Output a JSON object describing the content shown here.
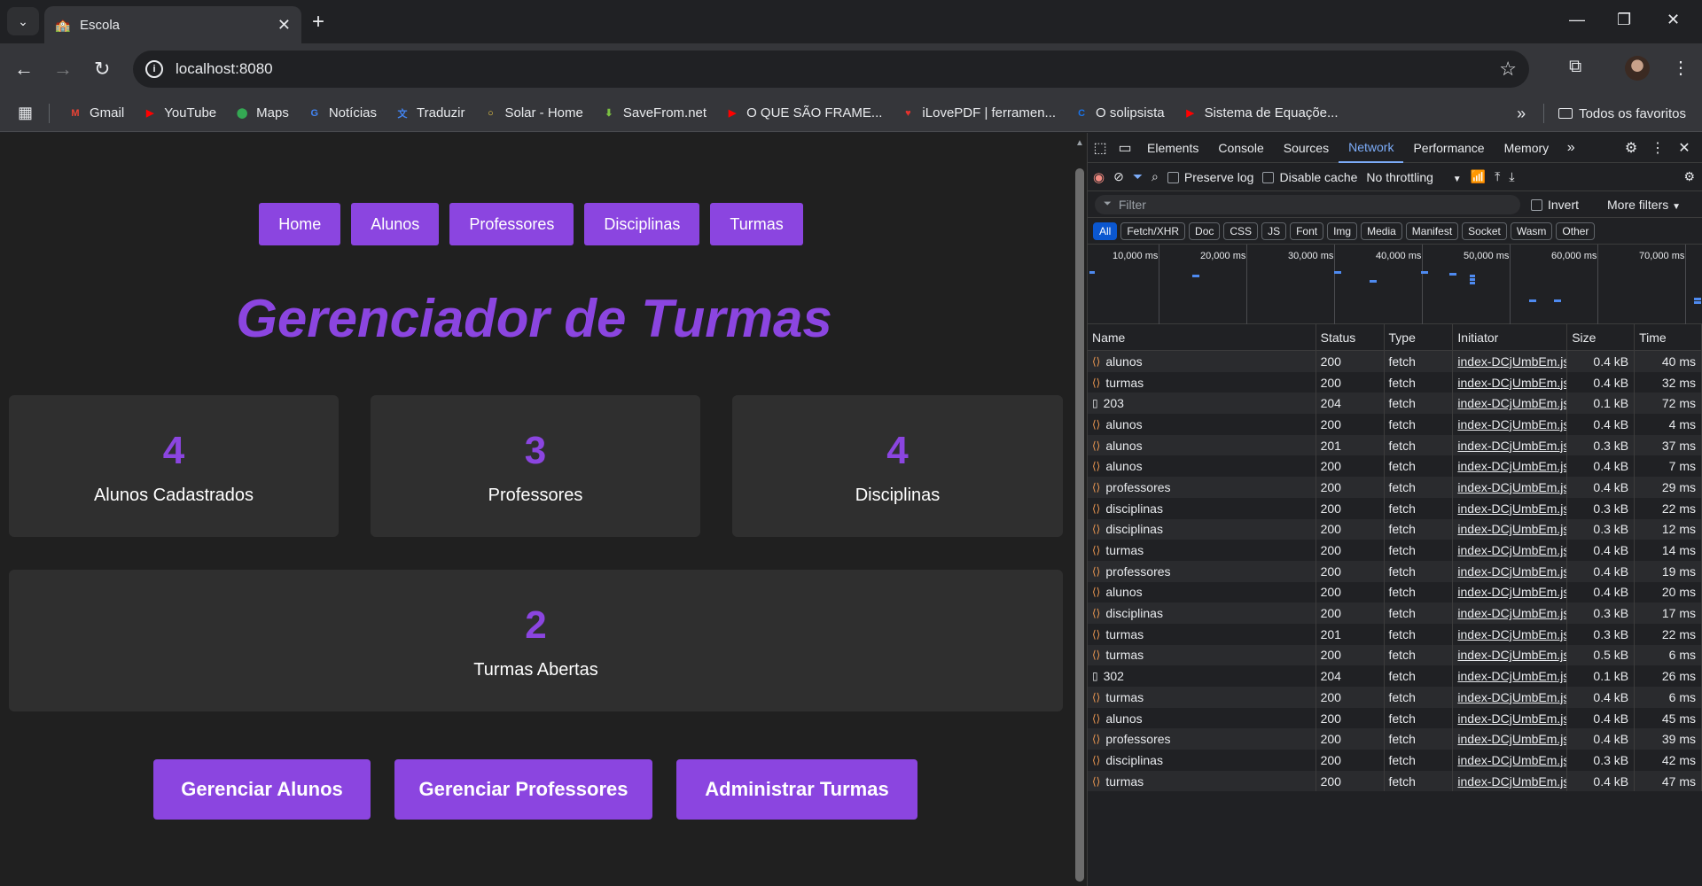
{
  "browser": {
    "tab_title": "Escola",
    "url": "localhost:8080",
    "bookmarks": [
      {
        "label": "Gmail",
        "icon": "gmail-icon",
        "color": "#ea4335",
        "glyph": "M"
      },
      {
        "label": "YouTube",
        "icon": "youtube-icon",
        "color": "#ff0000",
        "glyph": "▶"
      },
      {
        "label": "Maps",
        "icon": "maps-icon",
        "color": "#34a853",
        "glyph": "⬤"
      },
      {
        "label": "Notícias",
        "icon": "news-icon",
        "color": "#4285f4",
        "glyph": "G"
      },
      {
        "label": "Traduzir",
        "icon": "translate-icon",
        "color": "#4285f4",
        "glyph": "文"
      },
      {
        "label": "Solar - Home",
        "icon": "solar-icon",
        "color": "#f6d44a",
        "glyph": "○"
      },
      {
        "label": "SaveFrom.net",
        "icon": "savefrom-icon",
        "color": "#7cc142",
        "glyph": "⬇"
      },
      {
        "label": "O QUE SÃO FRAME...",
        "icon": "youtube-icon",
        "color": "#ff0000",
        "glyph": "▶"
      },
      {
        "label": "iLovePDF | ferramen...",
        "icon": "ilovepdf-icon",
        "color": "#e5322d",
        "glyph": "♥"
      },
      {
        "label": "O solipsista",
        "icon": "blog-icon",
        "color": "#1a73e8",
        "glyph": "C"
      },
      {
        "label": "Sistema de Equaçõe...",
        "icon": "youtube-icon",
        "color": "#ff0000",
        "glyph": "▶"
      }
    ],
    "all_favorites": "Todos os favoritos"
  },
  "app": {
    "nav": [
      "Home",
      "Alunos",
      "Professores",
      "Disciplinas",
      "Turmas"
    ],
    "heading": "Gerenciador de Turmas",
    "stats": [
      {
        "value": "4",
        "label": "Alunos Cadastrados"
      },
      {
        "value": "3",
        "label": "Professores"
      },
      {
        "value": "4",
        "label": "Disciplinas"
      },
      {
        "value": "2",
        "label": "Turmas Abertas"
      }
    ],
    "actions": [
      "Gerenciar Alunos",
      "Gerenciar Professores",
      "Administrar Turmas"
    ],
    "accent_color": "#8b45e0"
  },
  "devtools": {
    "tabs": [
      "Elements",
      "Console",
      "Sources",
      "Network",
      "Performance",
      "Memory"
    ],
    "active_tab": "Network",
    "preserve_log": "Preserve log",
    "disable_cache": "Disable cache",
    "throttling": "No throttling",
    "filter_placeholder": "Filter",
    "invert": "Invert",
    "more_filters": "More filters",
    "types": [
      "All",
      "Fetch/XHR",
      "Doc",
      "CSS",
      "JS",
      "Font",
      "Img",
      "Media",
      "Manifest",
      "Socket",
      "Wasm",
      "Other"
    ],
    "timeline_labels": [
      "10,000 ms",
      "20,000 ms",
      "30,000 ms",
      "40,000 ms",
      "50,000 ms",
      "60,000 ms",
      "70,000 ms"
    ],
    "columns": [
      "Name",
      "Status",
      "Type",
      "Initiator",
      "Size",
      "Time"
    ],
    "requests": [
      {
        "name": "alunos",
        "status": "200",
        "type": "fetch",
        "initiator": "index-DCjUmbEm.js:",
        "size": "0.4 kB",
        "time": "40 ms",
        "kind": "fetch"
      },
      {
        "name": "turmas",
        "status": "200",
        "type": "fetch",
        "initiator": "index-DCjUmbEm.js:",
        "size": "0.4 kB",
        "time": "32 ms",
        "kind": "fetch"
      },
      {
        "name": "203",
        "status": "204",
        "type": "fetch",
        "initiator": "index-DCjUmbEm.js:",
        "size": "0.1 kB",
        "time": "72 ms",
        "kind": "doc"
      },
      {
        "name": "alunos",
        "status": "200",
        "type": "fetch",
        "initiator": "index-DCjUmbEm.js:",
        "size": "0.4 kB",
        "time": "4 ms",
        "kind": "fetch"
      },
      {
        "name": "alunos",
        "status": "201",
        "type": "fetch",
        "initiator": "index-DCjUmbEm.js:",
        "size": "0.3 kB",
        "time": "37 ms",
        "kind": "fetch"
      },
      {
        "name": "alunos",
        "status": "200",
        "type": "fetch",
        "initiator": "index-DCjUmbEm.js:",
        "size": "0.4 kB",
        "time": "7 ms",
        "kind": "fetch"
      },
      {
        "name": "professores",
        "status": "200",
        "type": "fetch",
        "initiator": "index-DCjUmbEm.js:",
        "size": "0.4 kB",
        "time": "29 ms",
        "kind": "fetch"
      },
      {
        "name": "disciplinas",
        "status": "200",
        "type": "fetch",
        "initiator": "index-DCjUmbEm.js:",
        "size": "0.3 kB",
        "time": "22 ms",
        "kind": "fetch"
      },
      {
        "name": "disciplinas",
        "status": "200",
        "type": "fetch",
        "initiator": "index-DCjUmbEm.js:",
        "size": "0.3 kB",
        "time": "12 ms",
        "kind": "fetch"
      },
      {
        "name": "turmas",
        "status": "200",
        "type": "fetch",
        "initiator": "index-DCjUmbEm.js:",
        "size": "0.4 kB",
        "time": "14 ms",
        "kind": "fetch"
      },
      {
        "name": "professores",
        "status": "200",
        "type": "fetch",
        "initiator": "index-DCjUmbEm.js:",
        "size": "0.4 kB",
        "time": "19 ms",
        "kind": "fetch"
      },
      {
        "name": "alunos",
        "status": "200",
        "type": "fetch",
        "initiator": "index-DCjUmbEm.js:",
        "size": "0.4 kB",
        "time": "20 ms",
        "kind": "fetch"
      },
      {
        "name": "disciplinas",
        "status": "200",
        "type": "fetch",
        "initiator": "index-DCjUmbEm.js:",
        "size": "0.3 kB",
        "time": "17 ms",
        "kind": "fetch"
      },
      {
        "name": "turmas",
        "status": "201",
        "type": "fetch",
        "initiator": "index-DCjUmbEm.js:",
        "size": "0.3 kB",
        "time": "22 ms",
        "kind": "fetch"
      },
      {
        "name": "turmas",
        "status": "200",
        "type": "fetch",
        "initiator": "index-DCjUmbEm.js:",
        "size": "0.5 kB",
        "time": "6 ms",
        "kind": "fetch"
      },
      {
        "name": "302",
        "status": "204",
        "type": "fetch",
        "initiator": "index-DCjUmbEm.js:",
        "size": "0.1 kB",
        "time": "26 ms",
        "kind": "doc"
      },
      {
        "name": "turmas",
        "status": "200",
        "type": "fetch",
        "initiator": "index-DCjUmbEm.js:",
        "size": "0.4 kB",
        "time": "6 ms",
        "kind": "fetch"
      },
      {
        "name": "alunos",
        "status": "200",
        "type": "fetch",
        "initiator": "index-DCjUmbEm.js:",
        "size": "0.4 kB",
        "time": "45 ms",
        "kind": "fetch"
      },
      {
        "name": "professores",
        "status": "200",
        "type": "fetch",
        "initiator": "index-DCjUmbEm.js:",
        "size": "0.4 kB",
        "time": "39 ms",
        "kind": "fetch"
      },
      {
        "name": "disciplinas",
        "status": "200",
        "type": "fetch",
        "initiator": "index-DCjUmbEm.js:",
        "size": "0.3 kB",
        "time": "42 ms",
        "kind": "fetch"
      },
      {
        "name": "turmas",
        "status": "200",
        "type": "fetch",
        "initiator": "index-DCjUmbEm.js:",
        "size": "0.4 kB",
        "time": "47 ms",
        "kind": "fetch"
      }
    ]
  }
}
